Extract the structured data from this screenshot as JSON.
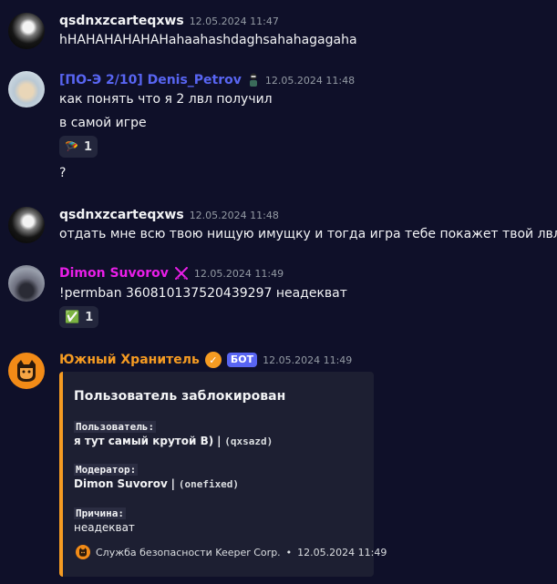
{
  "messages": [
    {
      "username": "qsdnxzcarteqxws",
      "timestamp": "12.05.2024 11:47",
      "lines": [
        "hHAHAHAHAHAHahaahashdaghsahahagagaha"
      ]
    },
    {
      "username": "[ПО-Э 2/10] Denis_Petrov",
      "badge_icon": "character-icon",
      "timestamp": "12.05.2024 11:48",
      "lines": [
        "как понять что я 2 лвл получил",
        "в самой игре",
        "?"
      ],
      "reaction": {
        "emoji": "🪂",
        "count": "1"
      }
    },
    {
      "username": "qsdnxzcarteqxws",
      "timestamp": "12.05.2024 11:48",
      "lines": [
        "отдать мне всю твою нищую имущку и тогда игра тебе покажет твой лвл"
      ]
    },
    {
      "username": "Dimon Suvorov",
      "badge_icon": "crossed-swords-icon",
      "timestamp": "12.05.2024 11:49",
      "lines": [
        "!permban 360810137520439297 неадекват"
      ],
      "reaction": {
        "emoji": "✅",
        "count": "1"
      }
    },
    {
      "username": "Южный Хранитель",
      "bot_label": "БОТ",
      "timestamp": "12.05.2024 11:49",
      "embed": {
        "title": "Пользователь заблокирован",
        "user_label": "Пользователь:",
        "user_name": "я тут самый крутой В)",
        "user_code": "(qxsazd)",
        "moderator_label": "Модератор:",
        "moderator_name": "Dimon Suvorov",
        "moderator_code": "(onefixed)",
        "reason_label": "Причина:",
        "reason_value": "неадекват",
        "footer_text": "Служба безопасности Keeper Corp.",
        "footer_timestamp": "12.05.2024 11:49"
      }
    }
  ],
  "colors": {
    "background": "#0f1029",
    "accent_orange": "#f59b22",
    "blurple": "#5865f2",
    "pink": "#e91ee8"
  }
}
